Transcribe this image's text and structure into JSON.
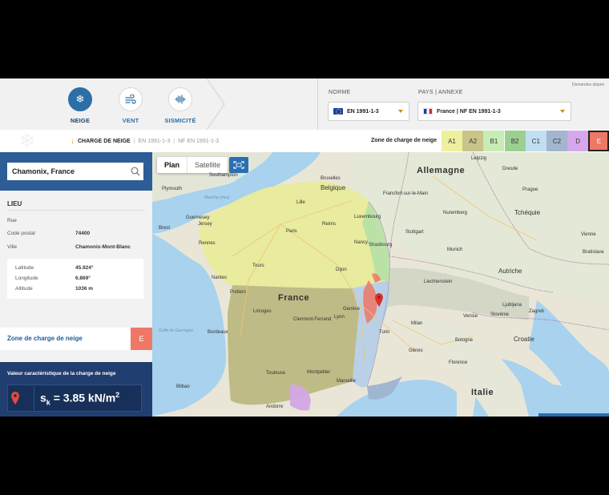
{
  "hazards": [
    {
      "label": "NEIGE",
      "icon": "snowflake-icon"
    },
    {
      "label": "VENT",
      "icon": "wind-icon"
    },
    {
      "label": "SISMICITÉ",
      "icon": "seismic-icon"
    }
  ],
  "form": {
    "norme_label": "NORME",
    "norme_value": "EN 1991-1-3",
    "pays_label": "PAYS | ANNEXE",
    "pays_value": "France | NF EN 1991-1-3",
    "demandes": "Demandes dispon"
  },
  "breadcrumb": {
    "current": "CHARGE DE NEIGE",
    "items": [
      "EN 1991-1-3",
      "NF EN 1991-1-3"
    ]
  },
  "zone_legend": {
    "label": "Zone de charge de neige",
    "zones": [
      {
        "name": "A1",
        "color": "#eef0a0"
      },
      {
        "name": "A2",
        "color": "#c8c48a"
      },
      {
        "name": "B1",
        "color": "#c7ecb4"
      },
      {
        "name": "B2",
        "color": "#9ccf90"
      },
      {
        "name": "C1",
        "color": "#c1dff1"
      },
      {
        "name": "C2",
        "color": "#a3b5cf"
      },
      {
        "name": "D",
        "color": "#d6a7eb"
      },
      {
        "name": "E",
        "color": "#ee7766",
        "selected": true
      }
    ]
  },
  "search": {
    "value": "Chamonix, France"
  },
  "lieu": {
    "title": "LIEU",
    "rue_label": "Rue",
    "rue_value": "",
    "cp_label": "Code postal",
    "cp_value": "74400",
    "ville_label": "Ville",
    "ville_value": "Chamonix-Mont-Blanc",
    "lat_label": "Latitude",
    "lat_value": "45.924°",
    "lon_label": "Longitude",
    "lon_value": "6.869°",
    "alt_label": "Altitude",
    "alt_value": "1036 m"
  },
  "zone_result": {
    "label": "Zone de charge de neige",
    "value": "E"
  },
  "result": {
    "title": "Valeur caractéristique de la charge de neige",
    "symbol": "s",
    "subscript": "k",
    "value": "= 3.85 kN/m",
    "superscript": "2"
  },
  "map": {
    "tabs": [
      "Plan",
      "Satellite"
    ],
    "labels": {
      "allemagne": "Allemagne",
      "france": "France",
      "belgique": "Belgique",
      "tchequie": "Tchéquie",
      "autriche": "Autriche",
      "italie": "Italie",
      "croatie": "Croatie",
      "slovenie": "Slovénie",
      "liechtenstein": "Liechtenstein",
      "paris": "Paris",
      "nantes": "Nantes",
      "lyon": "Lyon",
      "geneve": "Genève",
      "toulouse": "Toulouse",
      "marseille": "Marseille",
      "montpellier": "Montpellier",
      "bordeaux": "Bordeaux",
      "strasbourg": "Strasbourg",
      "rennes": "Rennes",
      "tours": "Tours",
      "reims": "Reims",
      "dijon": "Dijon",
      "nancy": "Nancy",
      "lille": "Lille",
      "luxembourg": "Luxembourg",
      "francfort": "Francfort-sur-le-Main",
      "nuremberg": "Nuremberg",
      "munich": "Munich",
      "stuttgart": "Stuttgart",
      "leipzig": "Leipzig",
      "dresde": "Dresde",
      "prague": "Prague",
      "vienne": "Vienne",
      "bratislava": "Bratislava",
      "milan": "Milan",
      "turin": "Turin",
      "genes": "Gênes",
      "venise": "Venise",
      "bologne": "Bologne",
      "florence": "Florence",
      "zagreb": "Zagreb",
      "ljubljana": "Ljubljana",
      "limoges": "Limoges",
      "poitiers": "Poitiers",
      "clermont": "Clermont-Ferrand",
      "brest": "Brest",
      "jersey": "Jersey",
      "guernesey": "Guernesey",
      "plymouth": "Plymouth",
      "southampton": "Southampton",
      "bruxelles": "Bruxelles",
      "bilbao": "Bilbao",
      "andorre": "Andorre",
      "manche": "Manche (mer)",
      "gascogne": "Golfe de Gascogne"
    }
  }
}
